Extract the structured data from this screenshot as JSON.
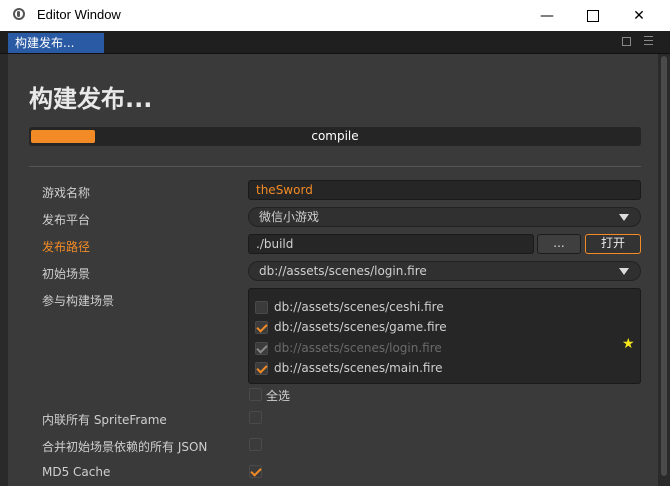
{
  "window": {
    "title": "Editor Window",
    "controls": {
      "minimize": "—",
      "close": "✕"
    }
  },
  "tab": {
    "label": "构建发布..."
  },
  "panel": {
    "heading": "构建发布...",
    "progress": {
      "label": "compile",
      "percent": 10.5,
      "color": "#f28a25"
    }
  },
  "form": {
    "game_name": {
      "label": "游戏名称",
      "value": "theSword"
    },
    "platform": {
      "label": "发布平台",
      "value": "微信小游戏"
    },
    "build_path": {
      "label": "发布路径",
      "value": "./build",
      "browse_label": "...",
      "open_label": "打开"
    },
    "start_scene": {
      "label": "初始场景",
      "value": "db://assets/scenes/login.fire"
    },
    "included_scenes": {
      "label": "参与构建场景",
      "items": [
        {
          "path": "db://assets/scenes/ceshi.fire",
          "checked": false,
          "disabled": false
        },
        {
          "path": "db://assets/scenes/game.fire",
          "checked": true,
          "disabled": false
        },
        {
          "path": "db://assets/scenes/login.fire",
          "checked": true,
          "disabled": true
        },
        {
          "path": "db://assets/scenes/main.fire",
          "checked": true,
          "disabled": false
        }
      ],
      "select_all_label": "全选",
      "start_scene_marker": "★"
    },
    "inline_spriteframes": {
      "label": "内联所有 SpriteFrame",
      "checked": false
    },
    "merge_start_scene_json": {
      "label": "合并初始场景依赖的所有 JSON",
      "checked": false
    },
    "md5_cache": {
      "label": "MD5 Cache",
      "checked": true
    }
  },
  "colors": {
    "accent": "#f28a25",
    "tab_active": "#2b5aa5",
    "star": "#f5e61b"
  }
}
